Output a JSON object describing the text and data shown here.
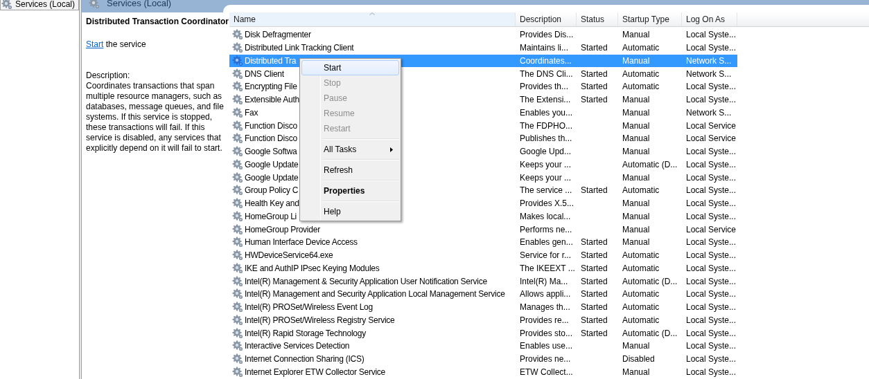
{
  "tree": {
    "items": [
      {
        "label": "Services (Local)",
        "selected": true
      }
    ]
  },
  "header": {
    "title": "Services (Local)"
  },
  "details": {
    "title": "Distributed Transaction Coordinator",
    "action": {
      "link": "Start",
      "text": "the service"
    },
    "description_label": "Description:",
    "description": "Coordinates transactions that span multiple resource managers, such as databases, message queues, and file systems. If this service is stopped, these transactions will fail. If this service is disabled, any services that explicitly depend on it will fail to start."
  },
  "table": {
    "columns": [
      {
        "label": "Name",
        "sorted": true
      },
      {
        "label": "Description",
        "sorted": false
      },
      {
        "label": "Status",
        "sorted": false
      },
      {
        "label": "Startup Type",
        "sorted": false
      },
      {
        "label": "Log On As",
        "sorted": false
      }
    ],
    "rows": [
      {
        "name": "Disk Defragmenter",
        "description": "Provides Dis...",
        "status": "",
        "startup": "Manual",
        "logon": "Local Syste...",
        "selected": false
      },
      {
        "name": "Distributed Link Tracking Client",
        "description": "Maintains li...",
        "status": "Started",
        "startup": "Automatic",
        "logon": "Local Syste...",
        "selected": false
      },
      {
        "name": "Distributed Tra",
        "description": "Coordinates...",
        "status": "",
        "startup": "Manual",
        "logon": "Network S...",
        "selected": true
      },
      {
        "name": "DNS Client",
        "description": "The DNS Cli...",
        "status": "Started",
        "startup": "Automatic",
        "logon": "Network S...",
        "selected": false
      },
      {
        "name": "Encrypting File",
        "description": "Provides th...",
        "status": "Started",
        "startup": "Automatic",
        "logon": "Local Syste...",
        "selected": false
      },
      {
        "name": "Extensible Auth",
        "description": "The Extensi...",
        "status": "Started",
        "startup": "Manual",
        "logon": "Local Syste...",
        "selected": false
      },
      {
        "name": "Fax",
        "description": "Enables you...",
        "status": "",
        "startup": "Manual",
        "logon": "Network S...",
        "selected": false
      },
      {
        "name": "Function Disco",
        "description": "The FDPHO...",
        "status": "",
        "startup": "Manual",
        "logon": "Local Service",
        "selected": false
      },
      {
        "name": "Function Disco",
        "description": "Publishes th...",
        "status": "",
        "startup": "Manual",
        "logon": "Local Service",
        "selected": false
      },
      {
        "name": "Google Softwa",
        "description": "Google Upd...",
        "status": "",
        "startup": "Manual",
        "logon": "Local Syste...",
        "selected": false
      },
      {
        "name": "Google Update",
        "description": "Keeps your ...",
        "status": "",
        "startup": "Automatic (D...",
        "logon": "Local Syste...",
        "selected": false
      },
      {
        "name": "Google Update",
        "description": "Keeps your ...",
        "status": "",
        "startup": "Manual",
        "logon": "Local Syste...",
        "selected": false
      },
      {
        "name": "Group Policy C",
        "description": "The service ...",
        "status": "Started",
        "startup": "Automatic",
        "logon": "Local Syste...",
        "selected": false
      },
      {
        "name": "Health Key and",
        "description": "Provides X.5...",
        "status": "",
        "startup": "Manual",
        "logon": "Local Syste...",
        "selected": false
      },
      {
        "name": "HomeGroup Li",
        "description": "Makes local...",
        "status": "",
        "startup": "Manual",
        "logon": "Local Syste...",
        "selected": false
      },
      {
        "name": "HomeGroup Provider",
        "description": "Performs ne...",
        "status": "",
        "startup": "Manual",
        "logon": "Local Service",
        "selected": false
      },
      {
        "name": "Human Interface Device Access",
        "description": "Enables gen...",
        "status": "Started",
        "startup": "Manual",
        "logon": "Local Syste...",
        "selected": false
      },
      {
        "name": "HWDeviceService64.exe",
        "description": "Service for r...",
        "status": "Started",
        "startup": "Automatic",
        "logon": "Local Syste...",
        "selected": false
      },
      {
        "name": "IKE and AuthIP IPsec Keying Modules",
        "description": "The IKEEXT ...",
        "status": "Started",
        "startup": "Automatic",
        "logon": "Local Syste...",
        "selected": false
      },
      {
        "name": "Intel(R) Management & Security Application User Notification Service",
        "description": "Intel(R) Ma...",
        "status": "Started",
        "startup": "Automatic (D...",
        "logon": "Local Syste...",
        "selected": false
      },
      {
        "name": "Intel(R) Management and Security Application Local Management Service",
        "description": "Allows appli...",
        "status": "Started",
        "startup": "Automatic",
        "logon": "Local Syste...",
        "selected": false
      },
      {
        "name": "Intel(R) PROSet/Wireless Event Log",
        "description": "Manages th...",
        "status": "Started",
        "startup": "Automatic",
        "logon": "Local Syste...",
        "selected": false
      },
      {
        "name": "Intel(R) PROSet/Wireless Registry Service",
        "description": "Provides re...",
        "status": "Started",
        "startup": "Automatic",
        "logon": "Local Syste...",
        "selected": false
      },
      {
        "name": "Intel(R) Rapid Storage Technology",
        "description": "Provides sto...",
        "status": "Started",
        "startup": "Automatic (D...",
        "logon": "Local Syste...",
        "selected": false
      },
      {
        "name": "Interactive Services Detection",
        "description": "Enables use...",
        "status": "",
        "startup": "Manual",
        "logon": "Local Syste...",
        "selected": false
      },
      {
        "name": "Internet Connection Sharing (ICS)",
        "description": "Provides ne...",
        "status": "",
        "startup": "Disabled",
        "logon": "Local Syste...",
        "selected": false
      },
      {
        "name": "Internet Explorer ETW Collector Service",
        "description": "ETW Collect...",
        "status": "",
        "startup": "Manual",
        "logon": "Local Syste...",
        "selected": false
      }
    ]
  },
  "context_menu": [
    {
      "kind": "item",
      "label": "Start",
      "disabled": false,
      "highlighted": true,
      "default": false,
      "submenu": false
    },
    {
      "kind": "item",
      "label": "Stop",
      "disabled": true,
      "highlighted": false,
      "default": false,
      "submenu": false
    },
    {
      "kind": "item",
      "label": "Pause",
      "disabled": true,
      "highlighted": false,
      "default": false,
      "submenu": false
    },
    {
      "kind": "item",
      "label": "Resume",
      "disabled": true,
      "highlighted": false,
      "default": false,
      "submenu": false
    },
    {
      "kind": "item",
      "label": "Restart",
      "disabled": true,
      "highlighted": false,
      "default": false,
      "submenu": false
    },
    {
      "kind": "separator"
    },
    {
      "kind": "item",
      "label": "All Tasks",
      "disabled": false,
      "highlighted": false,
      "default": false,
      "submenu": true
    },
    {
      "kind": "separator"
    },
    {
      "kind": "item",
      "label": "Refresh",
      "disabled": false,
      "highlighted": false,
      "default": false,
      "submenu": false
    },
    {
      "kind": "separator"
    },
    {
      "kind": "item",
      "label": "Properties",
      "disabled": false,
      "highlighted": false,
      "default": true,
      "submenu": false
    },
    {
      "kind": "separator"
    },
    {
      "kind": "item",
      "label": "Help",
      "disabled": false,
      "highlighted": false,
      "default": false,
      "submenu": false
    }
  ]
}
